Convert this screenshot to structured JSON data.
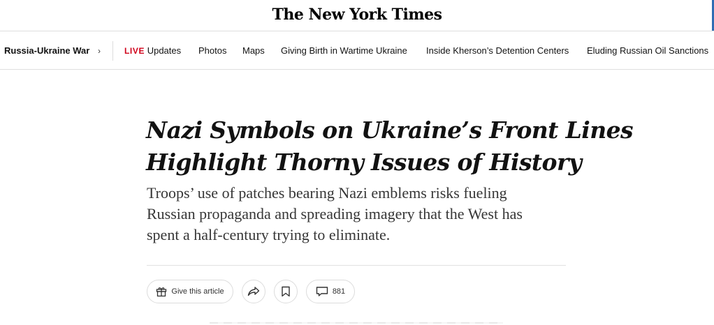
{
  "masthead": {
    "logo": "The New York Times"
  },
  "nav": {
    "section": "Russia-Ukraine War",
    "chevron": "›",
    "live_badge": "LIVE",
    "items": [
      "Updates",
      "Photos",
      "Maps",
      "Giving Birth in Wartime Ukraine",
      "Inside Kherson’s Detention Centers",
      "Eluding Russian Oil Sanctions"
    ]
  },
  "article": {
    "headline_lines": [
      "Nazi Symbols on Ukraine’s Front Lines",
      "Highlight Thorny Issues of History"
    ],
    "summary_lines": [
      "Troops’ use of patches bearing Nazi emblems risks fueling",
      "Russian propaganda and spreading imagery that the West has",
      "spent a half-century trying to eliminate."
    ]
  },
  "actions": {
    "give_label": "Give this article",
    "comment_count": "881",
    "icons": [
      "gift-icon",
      "share-icon",
      "bookmark-icon",
      "comment-icon"
    ]
  },
  "colors": {
    "live": "#d0021b",
    "text": "#121212",
    "summary": "#363636",
    "border": "#dcdcdc"
  }
}
